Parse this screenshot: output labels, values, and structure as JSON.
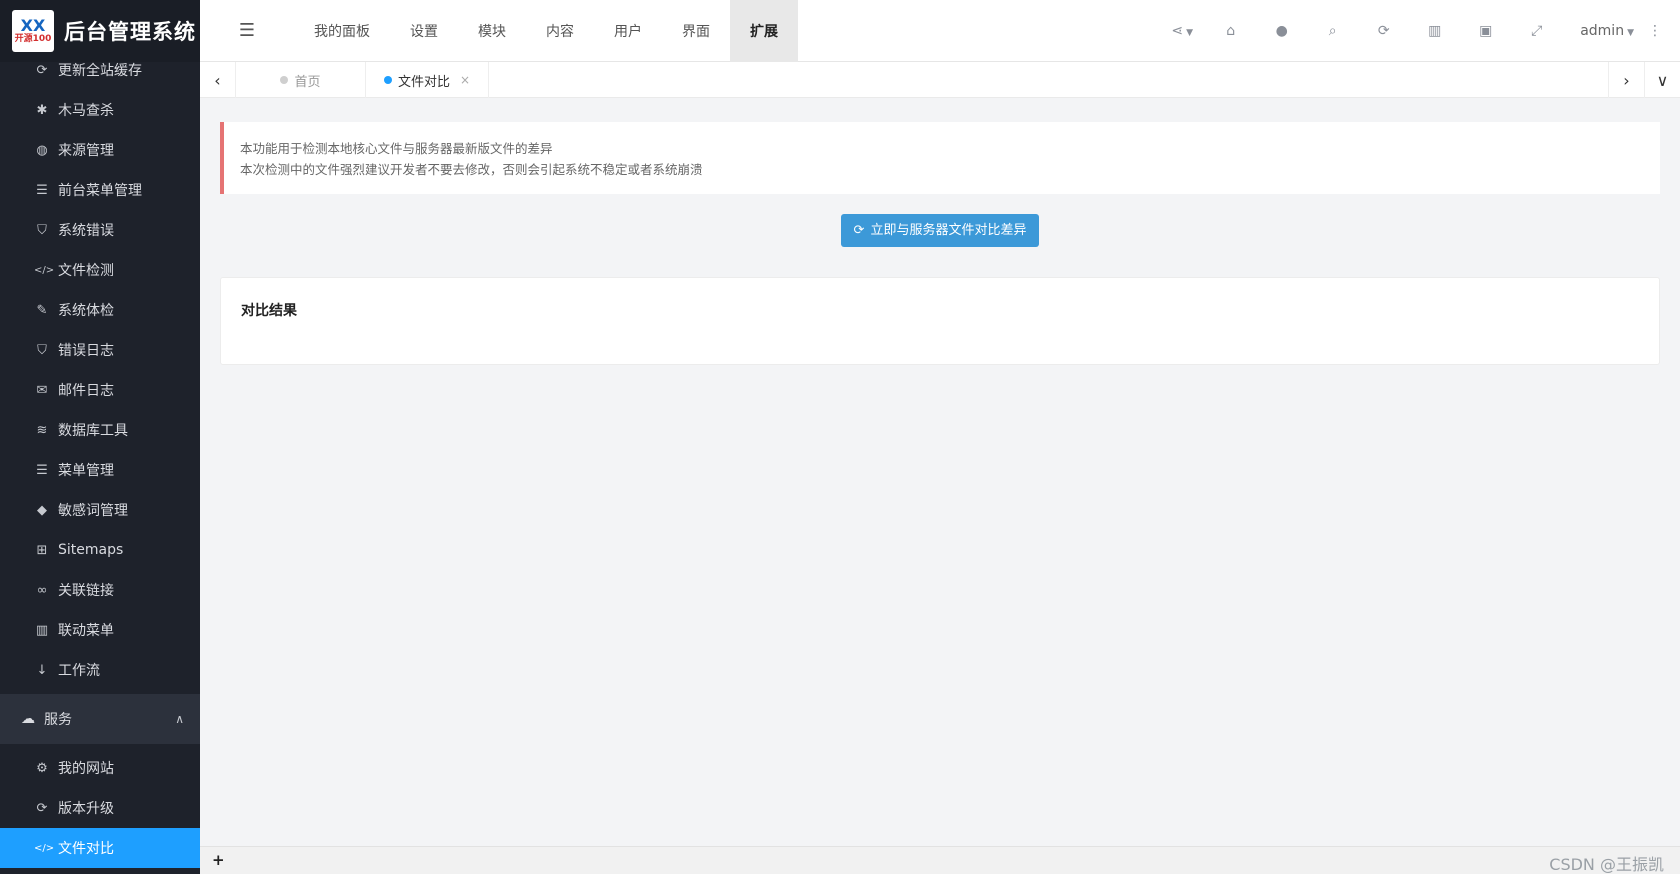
{
  "logo": {
    "mark_top": "XX",
    "mark_bottom": "开源100",
    "title": "后台管理系统"
  },
  "sidebar": {
    "items_top": [
      {
        "icon": "refresh-icon",
        "glyph": "⟳",
        "label": "更新全站缓存"
      },
      {
        "icon": "bug-icon",
        "glyph": "✱",
        "label": "木马查杀"
      },
      {
        "icon": "globe-icon",
        "glyph": "◍",
        "label": "来源管理"
      },
      {
        "icon": "list-icon",
        "glyph": "☰",
        "label": "前台菜单管理"
      },
      {
        "icon": "shield-icon",
        "glyph": "⛉",
        "label": "系统错误"
      },
      {
        "icon": "code-icon",
        "glyph": "</>",
        "label": "文件检测"
      },
      {
        "icon": "wrench-icon",
        "glyph": "✎",
        "label": "系统体检"
      },
      {
        "icon": "shield-icon",
        "glyph": "⛉",
        "label": "错误日志"
      },
      {
        "icon": "mail-icon",
        "glyph": "✉",
        "label": "邮件日志"
      },
      {
        "icon": "database-icon",
        "glyph": "≋",
        "label": "数据库工具"
      },
      {
        "icon": "list-icon",
        "glyph": "☰",
        "label": "菜单管理"
      },
      {
        "icon": "tag-icon",
        "glyph": "◆",
        "label": "敏感词管理"
      },
      {
        "icon": "sitemap-icon",
        "glyph": "⊞",
        "label": "Sitemaps"
      },
      {
        "icon": "link-icon",
        "glyph": "∞",
        "label": "关联链接"
      },
      {
        "icon": "columns-icon",
        "glyph": "▥",
        "label": "联动菜单"
      },
      {
        "icon": "sort-icon",
        "glyph": "↓",
        "label": "工作流"
      }
    ],
    "group": {
      "icon": "cloud-icon",
      "glyph": "☁",
      "label": "服务",
      "chevron": "∧"
    },
    "items_bottom": [
      {
        "icon": "gear-icon",
        "glyph": "⚙",
        "label": "我的网站"
      },
      {
        "icon": "refresh-icon",
        "glyph": "⟳",
        "label": "版本升级"
      },
      {
        "icon": "code-icon",
        "glyph": "</>",
        "label": "文件对比",
        "active": true
      }
    ]
  },
  "header": {
    "toggle_glyph": "☰",
    "tabs": [
      "我的面板",
      "设置",
      "模块",
      "内容",
      "用户",
      "界面",
      "扩展"
    ],
    "active_tab": "扩展",
    "icons": [
      {
        "name": "share-icon",
        "glyph": "⋖"
      },
      {
        "name": "home-icon",
        "glyph": "⌂"
      },
      {
        "name": "user-icon",
        "glyph": "●"
      },
      {
        "name": "search-icon",
        "glyph": "⌕"
      },
      {
        "name": "refresh-icon",
        "glyph": "⟳"
      },
      {
        "name": "trash-icon",
        "glyph": "▥"
      },
      {
        "name": "lock-icon",
        "glyph": "▣"
      },
      {
        "name": "fullscreen-icon",
        "glyph": "⤢"
      }
    ],
    "user": "admin",
    "more_glyph": "⋮"
  },
  "tabstrip": {
    "prev_glyph": "‹",
    "next_glyph": "›",
    "menu_glyph": "∨",
    "tabs": [
      {
        "label": "首页",
        "current": false
      },
      {
        "label": "文件对比",
        "current": true,
        "close": "×"
      }
    ]
  },
  "content": {
    "alert_line1": "本功能用于检测本地核心文件与服务器最新版文件的差异",
    "alert_line2": "本次检测中的文件强烈建议开发者不要去修改，否则会引起系统不稳定或者系统崩溃",
    "compare_button": "立即与服务器文件对比差异",
    "compare_button_glyph": "⟳",
    "result_title": "对比结果"
  },
  "footer": {
    "plus": "+",
    "watermark": "CSDN @王振凯"
  },
  "colors": {
    "sidebar_bg": "#1e222b",
    "accent": "#1e9fff",
    "button": "#3c99d8",
    "alert_border": "#e57373"
  }
}
